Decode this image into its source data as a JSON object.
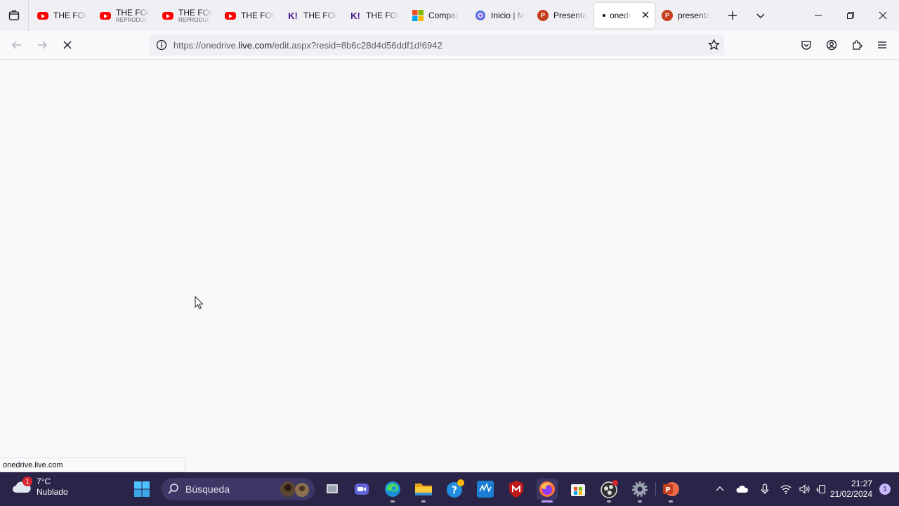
{
  "tabs": [
    {
      "title": "THE FOC",
      "subtitle": "",
      "favicon": "youtube",
      "color": "#ff0000"
    },
    {
      "title": "THE FOC",
      "subtitle": "REPRODUC",
      "favicon": "youtube",
      "color": "#ff0000"
    },
    {
      "title": "THE FOC",
      "subtitle": "REPRODUC",
      "favicon": "youtube",
      "color": "#ff0000"
    },
    {
      "title": "THE FOC",
      "subtitle": "",
      "favicon": "youtube",
      "color": "#ff0000"
    },
    {
      "title": "THE FOC",
      "subtitle": "",
      "favicon": "kahoot",
      "color": "#46178f"
    },
    {
      "title": "THE FOC",
      "subtitle": "",
      "favicon": "kahoot",
      "color": "#46178f"
    },
    {
      "title": "Compar",
      "subtitle": "",
      "favicon": "microsoft",
      "color": "#f25022"
    },
    {
      "title": "Inicio | M",
      "subtitle": "",
      "favicon": "copilot",
      "color": "#5b6ee1"
    },
    {
      "title": "Presenta",
      "subtitle": "",
      "favicon": "powerpoint",
      "color": "#c43e1c"
    },
    {
      "title": "onedr",
      "subtitle": "",
      "favicon": "loading",
      "color": "#15141a",
      "active": true
    },
    {
      "title": "presenta",
      "subtitle": "",
      "favicon": "powerpoint",
      "color": "#c43e1c"
    }
  ],
  "url": {
    "prefix": "https://onedrive.",
    "domain": "live.com",
    "path": "/edit.aspx?resid=8b6c28d4d56ddf1d!6942"
  },
  "status_text": "onedrive.live.com",
  "weather": {
    "temp": "7°C",
    "condition": "Nublado",
    "badge": "1"
  },
  "search_placeholder": "Búsqueda",
  "clock": {
    "time": "21:27",
    "date": "21/02/2024"
  },
  "notification_count": "1",
  "colors": {
    "taskbar": "#2a2548",
    "tabstrip": "#f0f0f4",
    "page": "#f9f9fb"
  }
}
